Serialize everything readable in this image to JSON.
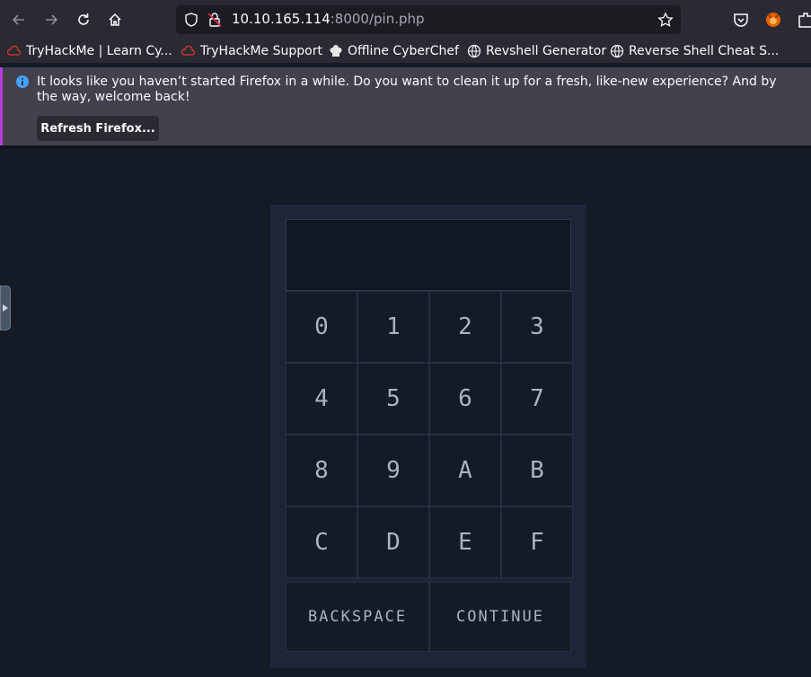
{
  "browser": {
    "url_host": "10.10.165.114",
    "url_path": ":8000/pin.php"
  },
  "bookmarks": [
    {
      "label": "TryHackMe | Learn Cy...",
      "icon": "tryhackme-icon"
    },
    {
      "label": "TryHackMe Support",
      "icon": "tryhackme-icon"
    },
    {
      "label": "Offline CyberChef",
      "icon": "chef-hat-icon"
    },
    {
      "label": "Revshell Generator",
      "icon": "globe-icon"
    },
    {
      "label": "Reverse Shell Cheat S...",
      "icon": "globe-icon"
    }
  ],
  "notification": {
    "message": "It looks like you haven’t started Firefox in a while. Do you want to clean it up for a fresh, like-new experience? And by the way, welcome back!",
    "button_label": "Refresh Firefox..."
  },
  "keypad": {
    "keys": [
      "0",
      "1",
      "2",
      "3",
      "4",
      "5",
      "6",
      "7",
      "8",
      "9",
      "A",
      "B",
      "C",
      "D",
      "E",
      "F"
    ],
    "backspace_label": "BACKSPACE",
    "continue_label": "CONTINUE"
  },
  "colors": {
    "page_background": "#141b27",
    "key_text": "#a9b3c1",
    "notice_accent": "#b83cd9"
  }
}
